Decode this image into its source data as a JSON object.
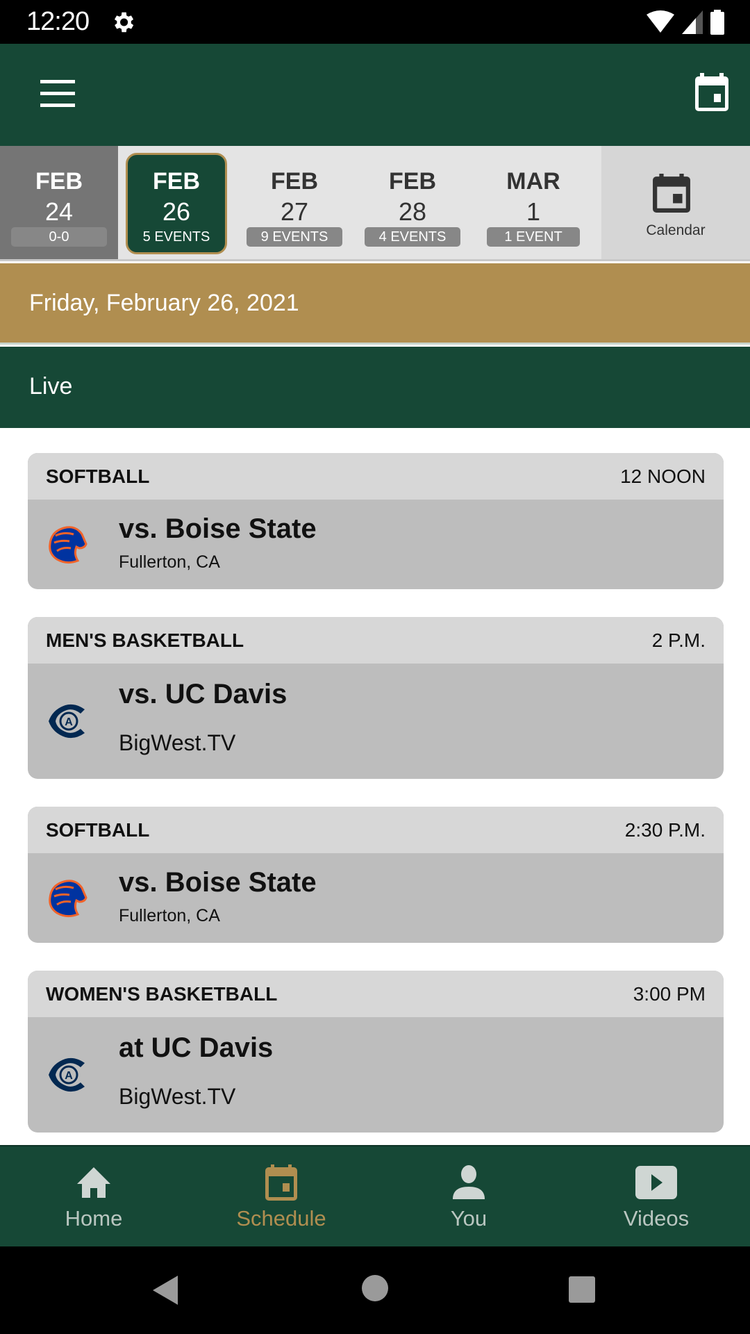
{
  "status_bar": {
    "time": "12:20",
    "icons": [
      "gear-icon",
      "wifi-icon",
      "signal-icon",
      "battery-icon"
    ]
  },
  "app_bar": {
    "menu_icon": "hamburger-menu-icon",
    "calendar_icon": "calendar-icon"
  },
  "date_strip": {
    "dates": [
      {
        "month": "FEB",
        "day": "24",
        "badge": "0-0",
        "state": "past"
      },
      {
        "month": "FEB",
        "day": "26",
        "badge": "5 EVENTS",
        "state": "selected"
      },
      {
        "month": "FEB",
        "day": "27",
        "badge": "9 EVENTS",
        "state": "future"
      },
      {
        "month": "FEB",
        "day": "28",
        "badge": "4 EVENTS",
        "state": "future"
      },
      {
        "month": "MAR",
        "day": "1",
        "badge": "1 EVENT",
        "state": "future"
      }
    ],
    "calendar_label": "Calendar"
  },
  "date_header": "Friday, February 26, 2021",
  "section_header": "Live",
  "events": [
    {
      "sport": "SOFTBALL",
      "time": "12 NOON",
      "opponent": "vs. Boise State",
      "detail": "Fullerton, CA",
      "logo": "boise-state-bronco-logo"
    },
    {
      "sport": "MEN'S BASKETBALL",
      "time": "2 P.M.",
      "opponent": "vs. UC Davis",
      "detail": "BigWest.TV",
      "logo": "uc-davis-logo"
    },
    {
      "sport": "SOFTBALL",
      "time": "2:30 P.M.",
      "opponent": "vs. Boise State",
      "detail": "Fullerton, CA",
      "logo": "boise-state-bronco-logo"
    },
    {
      "sport": "WOMEN'S BASKETBALL",
      "time": "3:00 PM",
      "opponent": "at UC Davis",
      "detail": "BigWest.TV",
      "logo": "uc-davis-logo"
    }
  ],
  "bottom_nav": [
    {
      "label": "Home",
      "icon": "home-icon",
      "active": false
    },
    {
      "label": "Schedule",
      "icon": "calendar-icon",
      "active": true
    },
    {
      "label": "You",
      "icon": "person-icon",
      "active": false
    },
    {
      "label": "Videos",
      "icon": "play-video-icon",
      "active": false
    }
  ],
  "colors": {
    "brand_green": "#164836",
    "brand_gold": "#b08e50",
    "card_header": "#d7d7d7",
    "card_body": "#bdbdbd"
  }
}
